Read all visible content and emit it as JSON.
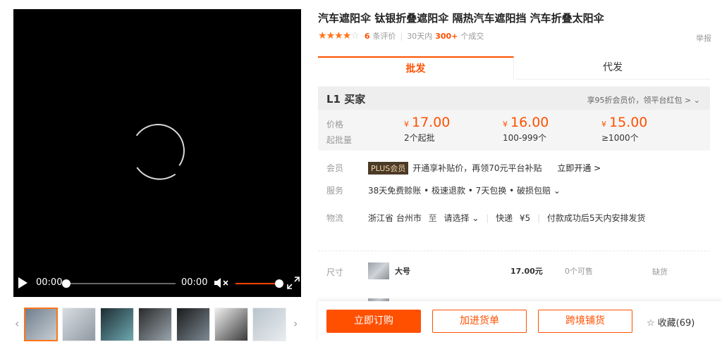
{
  "video": {
    "current_time": "00:00",
    "duration": "00:00"
  },
  "thumbnails": {
    "prev_arrow": "‹",
    "next_arrow": "›",
    "items": [
      {
        "colors": [
          "#6f7e8c",
          "#c9cfd4"
        ]
      },
      {
        "colors": [
          "#d8dde2",
          "#8f99a3"
        ]
      },
      {
        "colors": [
          "#1c2d33",
          "#6fa8b0"
        ]
      },
      {
        "colors": [
          "#2a2a2a",
          "#9aa5ad"
        ]
      },
      {
        "colors": [
          "#1b1b1b",
          "#7d8a94"
        ]
      },
      {
        "colors": [
          "#f0f0f0",
          "#3a3a3a"
        ]
      },
      {
        "colors": [
          "#b9c4cc",
          "#e8ecef"
        ]
      }
    ]
  },
  "product": {
    "title": "汽车遮阳伞 钛银折叠遮阳伞 隔热汽车遮阳挡 汽车折叠太阳伞",
    "rating_stars": 4,
    "review_count": "6",
    "review_label": "条评价",
    "sales_prefix": "30天内",
    "sales_count": "300+",
    "sales_suffix": "个成交",
    "report": "举报"
  },
  "tabs": [
    {
      "label": "批发"
    },
    {
      "label": "代发"
    }
  ],
  "pricing": {
    "level": "L1",
    "level_label": "买家",
    "vip_note": "享95折会员价，领平台红包 > ⌄",
    "price_label": "价格",
    "qty_label": "起批量",
    "currency": "¥",
    "tiers": [
      {
        "price": "17.00",
        "qty": "2个起批"
      },
      {
        "price": "16.00",
        "qty": "100-999个"
      },
      {
        "price": "15.00",
        "qty": "≥1000个"
      }
    ]
  },
  "member": {
    "label": "会员",
    "badge": "PLUS会员",
    "text": "开通享补贴价，再领70元平台补贴",
    "link": "立即开通 >"
  },
  "service": {
    "label": "服务",
    "text": "38天免费赊账 • 极速退款 • 7天包换 • 破损包赔 ⌄"
  },
  "logistics": {
    "label": "物流",
    "origin": "浙江省 台州市",
    "to": "至",
    "select": "请选择 ⌄",
    "express": "快递",
    "fee": "¥5",
    "ship_note": "付款成功后5天内安排发货"
  },
  "size": {
    "label": "尺寸",
    "option": "大号",
    "price": "17.00元",
    "stock": "0个可售",
    "status": "缺货"
  },
  "actions": {
    "buy_now": "立即订购",
    "add_cart": "加进货单",
    "cross_border": "跨境铺货",
    "favorite": "收藏(69)"
  }
}
